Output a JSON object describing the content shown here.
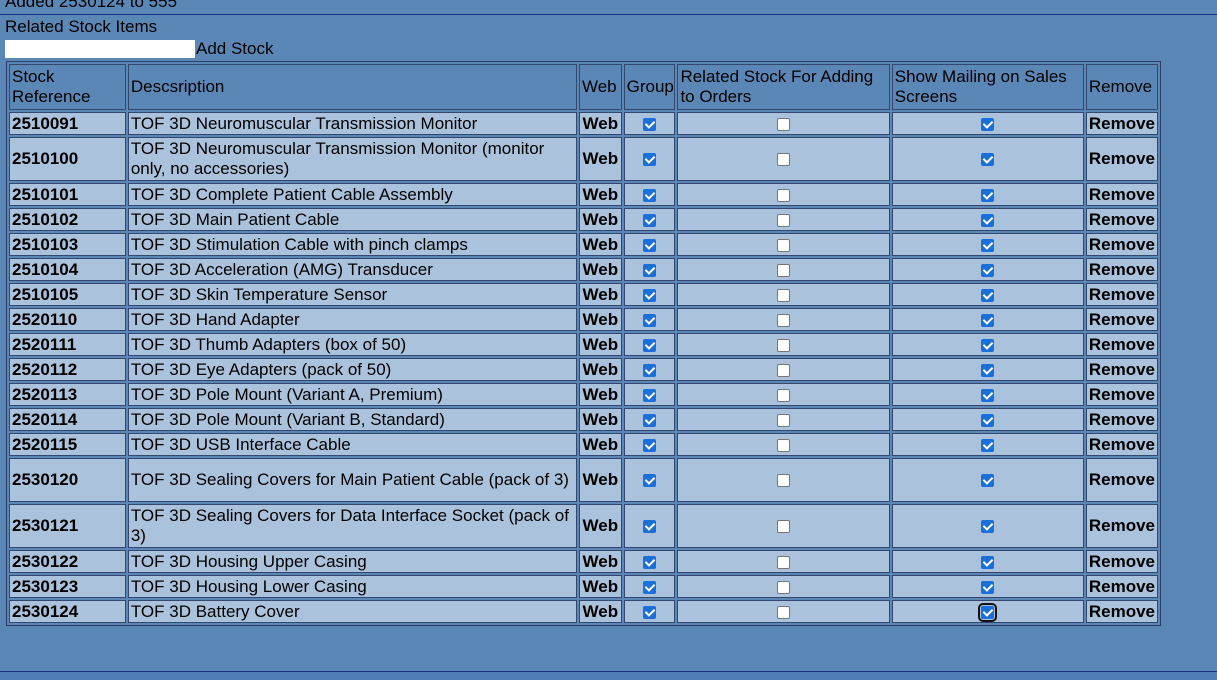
{
  "header": {
    "status_message": "Added 2530124 to 555",
    "section_title": "Related Stock Items",
    "add_input_value": "",
    "add_link": "Add Stock"
  },
  "table": {
    "columns": {
      "ref": "Stock Reference",
      "desc": "Descsription",
      "web": "Web",
      "group": "Group",
      "related": "Related Stock For Adding to Orders",
      "mailing": "Show Mailing on Sales Screens",
      "remove": "Remove"
    },
    "rows": [
      {
        "ref": "2510091",
        "desc": "TOF 3D Neuromuscular Transmission Monitor",
        "web": "Web",
        "group": true,
        "related": false,
        "mailing": true,
        "remove": "Remove"
      },
      {
        "ref": "2510100",
        "desc": "TOF 3D Neuromuscular Transmission Monitor (monitor only, no accessories)",
        "web": "Web",
        "group": true,
        "related": false,
        "mailing": true,
        "remove": "Remove"
      },
      {
        "ref": "2510101",
        "desc": "TOF 3D Complete Patient Cable Assembly",
        "web": "Web",
        "group": true,
        "related": false,
        "mailing": true,
        "remove": "Remove"
      },
      {
        "ref": "2510102",
        "desc": "TOF 3D Main Patient Cable",
        "web": "Web",
        "group": true,
        "related": false,
        "mailing": true,
        "remove": "Remove"
      },
      {
        "ref": "2510103",
        "desc": "TOF 3D Stimulation Cable with pinch clamps",
        "web": "Web",
        "group": true,
        "related": false,
        "mailing": true,
        "remove": "Remove"
      },
      {
        "ref": "2510104",
        "desc": "TOF 3D Acceleration (AMG) Transducer",
        "web": "Web",
        "group": true,
        "related": false,
        "mailing": true,
        "remove": "Remove"
      },
      {
        "ref": "2510105",
        "desc": "TOF 3D Skin Temperature Sensor",
        "web": "Web",
        "group": true,
        "related": false,
        "mailing": true,
        "remove": "Remove"
      },
      {
        "ref": "2520110",
        "desc": "TOF 3D Hand Adapter",
        "web": "Web",
        "group": true,
        "related": false,
        "mailing": true,
        "remove": "Remove"
      },
      {
        "ref": "2520111",
        "desc": "TOF 3D Thumb Adapters (box of 50)",
        "web": "Web",
        "group": true,
        "related": false,
        "mailing": true,
        "remove": "Remove"
      },
      {
        "ref": "2520112",
        "desc": "TOF 3D Eye Adapters (pack of 50)",
        "web": "Web",
        "group": true,
        "related": false,
        "mailing": true,
        "remove": "Remove"
      },
      {
        "ref": "2520113",
        "desc": "TOF 3D Pole Mount (Variant A, Premium)",
        "web": "Web",
        "group": true,
        "related": false,
        "mailing": true,
        "remove": "Remove"
      },
      {
        "ref": "2520114",
        "desc": "TOF 3D Pole Mount (Variant B, Standard)",
        "web": "Web",
        "group": true,
        "related": false,
        "mailing": true,
        "remove": "Remove"
      },
      {
        "ref": "2520115",
        "desc": "TOF 3D USB Interface Cable",
        "web": "Web",
        "group": true,
        "related": false,
        "mailing": true,
        "remove": "Remove"
      },
      {
        "ref": "2530120",
        "desc": "TOF 3D Sealing Covers for Main Patient Cable (pack of 3)",
        "web": "Web",
        "group": true,
        "related": false,
        "mailing": true,
        "remove": "Remove"
      },
      {
        "ref": "2530121",
        "desc": "TOF 3D Sealing Covers for Data Interface Socket (pack of 3)",
        "web": "Web",
        "group": true,
        "related": false,
        "mailing": true,
        "remove": "Remove"
      },
      {
        "ref": "2530122",
        "desc": "TOF 3D Housing Upper Casing",
        "web": "Web",
        "group": true,
        "related": false,
        "mailing": true,
        "remove": "Remove"
      },
      {
        "ref": "2530123",
        "desc": "TOF 3D Housing Lower Casing",
        "web": "Web",
        "group": true,
        "related": false,
        "mailing": true,
        "remove": "Remove"
      },
      {
        "ref": "2530124",
        "desc": "TOF 3D Battery Cover",
        "web": "Web",
        "group": true,
        "related": false,
        "mailing": true,
        "remove": "Remove"
      }
    ]
  },
  "colors": {
    "page_background": "#5b87b6",
    "cell_background": "#aac2dc",
    "checkbox_checked": "#1a6fd8"
  }
}
